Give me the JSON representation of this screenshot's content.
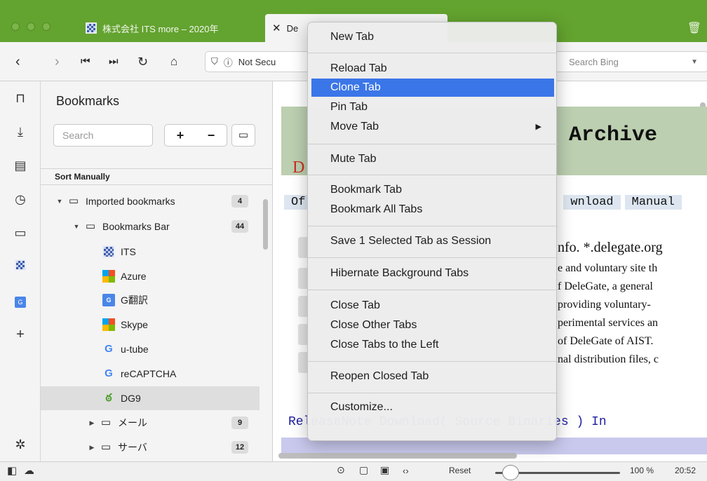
{
  "tabs": [
    {
      "title": "株式会社 ITS more – 2020年"
    },
    {
      "title": "De"
    }
  ],
  "toolbar": {
    "url_status": "Not Secu",
    "search_placeholder": "Search Bing"
  },
  "sidebar": {
    "title": "Bookmarks",
    "search_placeholder": "Search",
    "add": "+",
    "remove": "−",
    "sort_label": "Sort Manually"
  },
  "bookmarks": [
    {
      "label": "Imported bookmarks",
      "count": "4"
    },
    {
      "label": "Bookmarks Bar",
      "count": "44"
    },
    {
      "label": "ITS"
    },
    {
      "label": "Azure"
    },
    {
      "label": "G翻訳"
    },
    {
      "label": "Skype"
    },
    {
      "label": "u-tube"
    },
    {
      "label": "reCAPTCHA"
    },
    {
      "label": "DG9"
    },
    {
      "label": "メール",
      "count": "9"
    },
    {
      "label": "サーバ",
      "count": "12"
    }
  ],
  "context_menu": {
    "items": [
      "New Tab",
      "Reload Tab",
      "Clone Tab",
      "Pin Tab",
      "Move Tab",
      "Mute Tab",
      "Bookmark Tab",
      "Bookmark All Tabs",
      "Save 1 Selected Tab as Session",
      "Hibernate Background Tabs",
      "Close Tab",
      "Close Other Tabs",
      "Close Tabs to the Left",
      "Reopen Closed Tab",
      "Customize..."
    ]
  },
  "content": {
    "banner_title": "Archive",
    "dg_fragment": "D",
    "nav_buttons": [
      "Of",
      "wnload",
      "Manual"
    ],
    "lines": [
      "nfo. *.delegate.org",
      "e and voluntary site th",
      "f DeleGate, a general",
      "providing voluntary-",
      "perimental services an",
      "of DeleGate of AIST.",
      "nal distribution files, c"
    ],
    "release_text": "ReleaseNote Download( Source Binaries ) In"
  },
  "statusbar": {
    "reset": "Reset",
    "zoom": "100 %",
    "time": "20:52"
  }
}
